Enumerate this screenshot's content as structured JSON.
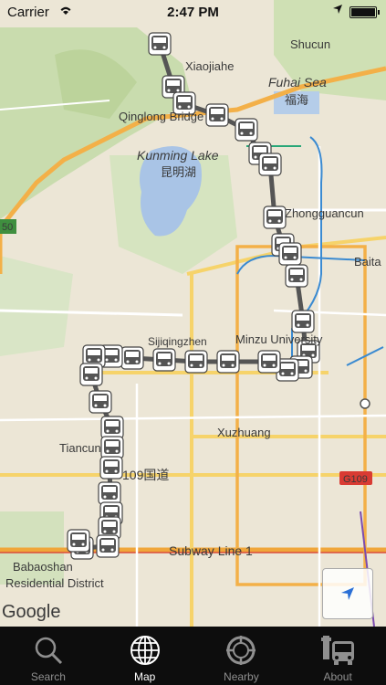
{
  "status_bar": {
    "carrier": "Carrier",
    "time": "2:47 PM"
  },
  "map": {
    "labels": {
      "shucun": "Shucun",
      "xiaojiahe": "Xiaojiahe",
      "fuhai_sea": "Fuhai Sea",
      "fuhai_cn": "福海",
      "qinglong": "Qinglong Bridge",
      "kunming_lake": "Kunming Lake",
      "kunming_cn": "昆明湖",
      "zhongguancun": "Zhongguancun",
      "baita": "Baita",
      "minzu": "Minzu University",
      "siji": "Sijiqingzhen",
      "xuzhuang": "Xuzhuang",
      "tiancun": "Tiancun",
      "guodao": "109国道",
      "g109": "G109",
      "subway": "Subway Line 1",
      "babaoshan": "Babaoshan",
      "residential": "Residential District",
      "google": "Google",
      "road_50": "50"
    }
  },
  "tabs": [
    {
      "label": "Search",
      "icon": "magnifier-icon",
      "active": false
    },
    {
      "label": "Map",
      "icon": "globe-icon",
      "active": true
    },
    {
      "label": "Nearby",
      "icon": "crosshair-icon",
      "active": false
    },
    {
      "label": "About",
      "icon": "bus-stop-icon",
      "active": false
    }
  ]
}
